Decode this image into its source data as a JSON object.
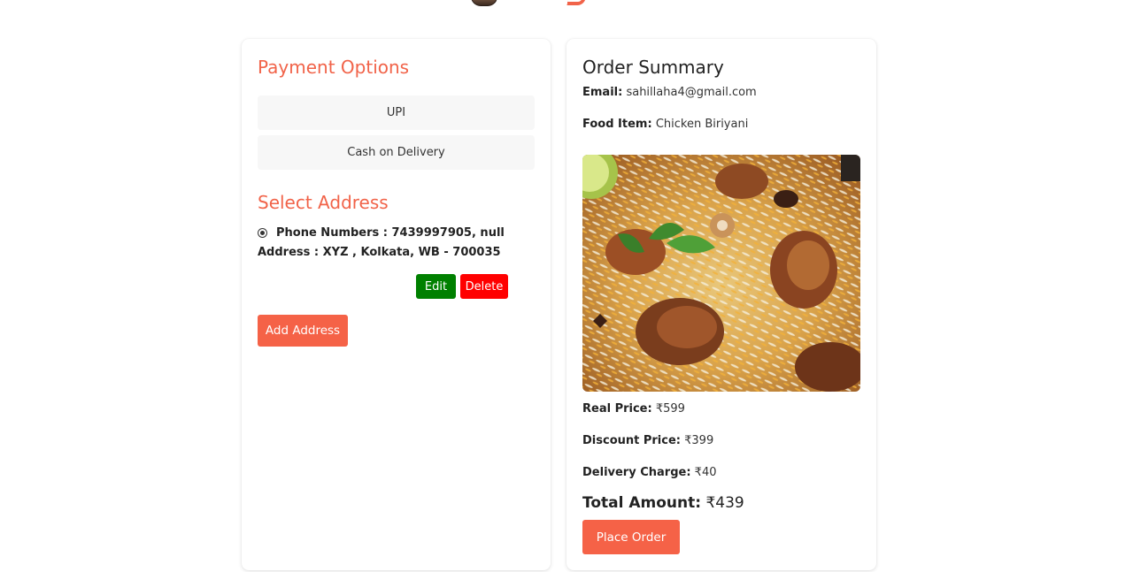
{
  "payment": {
    "title": "Payment Options",
    "options": [
      "UPI",
      "Cash on Delivery"
    ]
  },
  "address": {
    "title": "Select Address",
    "phone_label": "Phone Numbers : ",
    "phone_value": "7439997905, null",
    "address_label": "Address : ",
    "address_value": "XYZ , Kolkata, WB - 700035",
    "edit_label": "Edit",
    "delete_label": "Delete",
    "add_label": "Add Address"
  },
  "summary": {
    "title": "Order Summary",
    "email_label": "Email:",
    "email_value": "sahillaha4@gmail.com",
    "food_label": "Food Item:",
    "food_value": "Chicken Biriyani",
    "image_icon": "biryani-photo",
    "real_price_label": "Real Price:",
    "real_price_value": "₹599",
    "discount_label": "Discount Price:",
    "discount_value": "₹399",
    "delivery_label": "Delivery Charge:",
    "delivery_value": "₹40",
    "total_label": "Total Amount:",
    "total_value": "₹439",
    "place_order_label": "Place Order"
  },
  "colors": {
    "accent": "#f16349",
    "edit": "#008000",
    "delete": "#ff0000"
  }
}
